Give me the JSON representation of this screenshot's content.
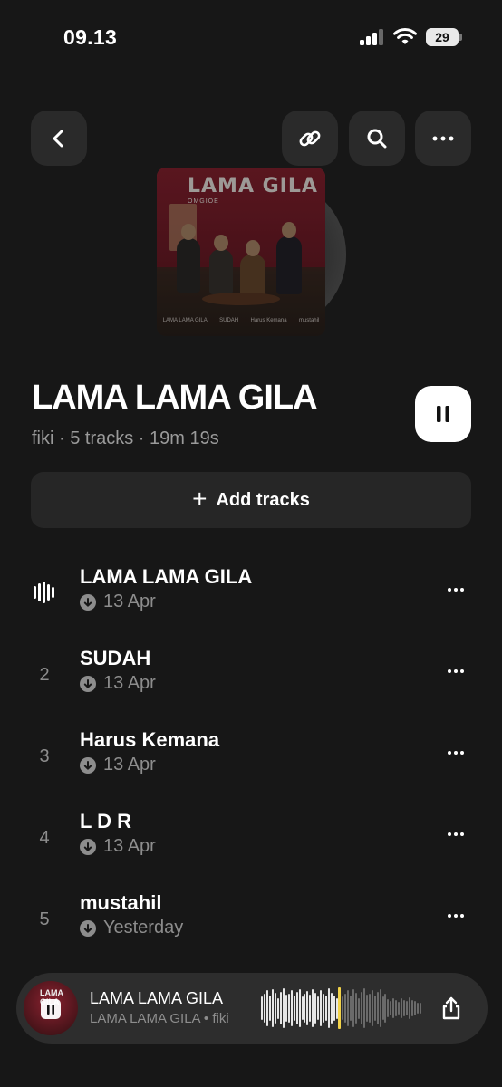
{
  "status": {
    "time": "09.13",
    "battery": "29"
  },
  "nav": {
    "back_icon": "chevron-left-icon",
    "link_icon": "link-icon",
    "search_icon": "search-icon",
    "more_icon": "ellipsis-icon"
  },
  "cover": {
    "title": "LAMA GILA",
    "subtitle": "OMGIOE",
    "tracks_text": [
      "LAMA LAMA GILA",
      "SUDAH",
      "Harus Kemana",
      "mustahil"
    ]
  },
  "playlist": {
    "title": "LAMA LAMA GILA",
    "meta": "fiki · 5 tracks · 19m 19s",
    "add_tracks_label": "Add tracks"
  },
  "tracks": [
    {
      "number": "",
      "playing": true,
      "title": "LAMA LAMA GILA",
      "date": "13 Apr"
    },
    {
      "number": "2",
      "playing": false,
      "title": "SUDAH",
      "date": "13 Apr"
    },
    {
      "number": "3",
      "playing": false,
      "title": "Harus Kemana",
      "date": "13 Apr"
    },
    {
      "number": "4",
      "playing": false,
      "title": "L D R",
      "date": "13 Apr"
    },
    {
      "number": "5",
      "playing": false,
      "title": "mustahil",
      "date": "Yesterday"
    }
  ],
  "mini_player": {
    "title": "LAMA LAMA GILA",
    "subtitle": "LAMA LAMA GILA • fiki",
    "art_text": "LAMA GILA",
    "progress": 0.48,
    "accent": "#f2d34a"
  }
}
